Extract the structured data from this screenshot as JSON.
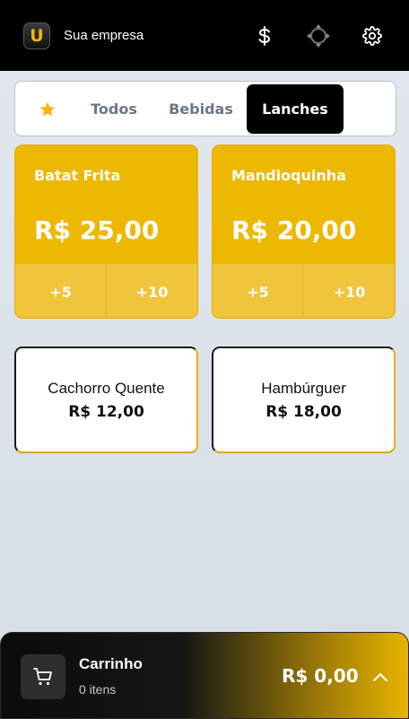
{
  "header": {
    "logo_letter": "U",
    "company_name": "Sua empresa",
    "icons": [
      "dollar-icon",
      "sync-icon",
      "gear-icon"
    ]
  },
  "tabs": [
    {
      "label": "",
      "icon": "star-icon",
      "active": false
    },
    {
      "label": "Todos",
      "active": false
    },
    {
      "label": "Bebidas",
      "active": false
    },
    {
      "label": "Lanches",
      "active": true
    }
  ],
  "featured_products": [
    {
      "name": "Batat Frita",
      "price": "R$ 25,00",
      "qty_buttons": [
        "+5",
        "+10"
      ]
    },
    {
      "name": "Mandioquinha",
      "price": "R$ 20,00",
      "qty_buttons": [
        "+5",
        "+10"
      ]
    }
  ],
  "products": [
    {
      "name": "Cachorro Quente",
      "price": "R$ 12,00"
    },
    {
      "name": "Hambúrguer",
      "price": "R$ 18,00"
    }
  ],
  "cart": {
    "title": "Carrinho",
    "count": "0 itens",
    "total": "R$ 0,00"
  },
  "colors": {
    "accent": "#ecb802",
    "header_bg": "#000000",
    "active_tab_bg": "#000000",
    "star": "#f2b705"
  }
}
